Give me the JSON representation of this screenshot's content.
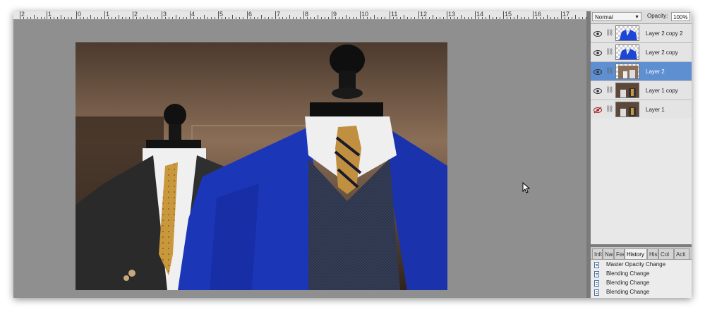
{
  "ruler": {
    "labels": [
      "2",
      "1",
      "0",
      "1",
      "2",
      "3",
      "4",
      "5",
      "6",
      "7",
      "8",
      "9",
      "10",
      "11",
      "12",
      "13",
      "14",
      "15",
      "16",
      "17"
    ]
  },
  "layers_panel": {
    "blend_mode": "Normal",
    "opacity_label": "Opacity:",
    "opacity_value": "100%",
    "layers": [
      {
        "name": "Layer 2 copy 2",
        "visible": true,
        "selected": false,
        "thumb": "checker-blue"
      },
      {
        "name": "Layer 2 copy",
        "visible": true,
        "selected": false,
        "thumb": "checker-blue"
      },
      {
        "name": "Layer 2",
        "visible": true,
        "selected": true,
        "thumb": "checker-photo"
      },
      {
        "name": "Layer 1 copy",
        "visible": true,
        "selected": false,
        "thumb": "photo"
      },
      {
        "name": "Layer 1",
        "visible": false,
        "selected": false,
        "thumb": "photo"
      }
    ]
  },
  "tabs": [
    "Info",
    "Nav",
    "Fav",
    "History",
    "Hist",
    "Col",
    "Acti"
  ],
  "active_tab": "History",
  "history": [
    "Master Opacity Change",
    "Blending Change",
    "Blending Change",
    "Blending Change"
  ],
  "colors": {
    "selected_layer": "#5d8fd1",
    "workspace": "#8f8f8f",
    "jacket_blue": "#1c36b8"
  },
  "icons": {
    "visibility": "eye-icon",
    "hidden": "eye-slash-icon",
    "link": "chain-link-icon",
    "history_item": "history-state-icon",
    "cursor": "mouse-pointer-icon"
  }
}
